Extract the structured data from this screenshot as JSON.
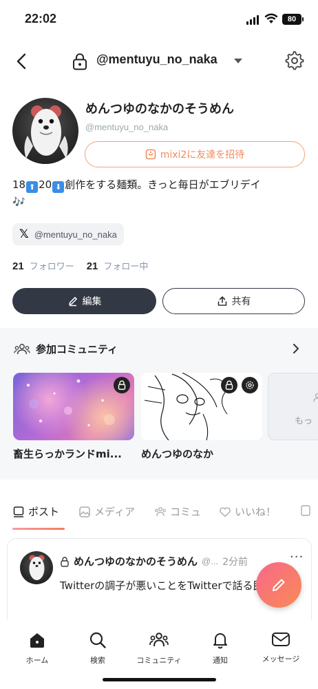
{
  "status_bar": {
    "time": "22:02",
    "battery": "80"
  },
  "header": {
    "username": "@mentuyu_no_naka"
  },
  "profile": {
    "display_name": "めんつゆのなかのそうめん",
    "handle": "@mentuyu_no_naka",
    "invite_label": "mixi2に友達を招待",
    "bio": {
      "age_from": "18",
      "up_arrow": "⬆",
      "age_to": "20",
      "down_arrow": "⬇",
      "text": "創作をする麺類。きっと毎日がエブリデイ",
      "note": "🎶"
    },
    "x_handle": "@mentuyu_no_naka",
    "followers_count": "21",
    "followers_label": "フォロワー",
    "following_count": "21",
    "following_label": "フォロー中",
    "edit_label": "編集",
    "share_label": "共有"
  },
  "community": {
    "title": "参加コミュニティ",
    "cards": [
      {
        "name": "畜生らっかランドmi..."
      },
      {
        "name": "めんつゆのなか"
      },
      {
        "name": "もっ"
      }
    ]
  },
  "tabs": [
    {
      "label": "ポスト",
      "icon": "post-icon"
    },
    {
      "label": "メディア",
      "icon": "media-icon"
    },
    {
      "label": "コミュ",
      "icon": "community-icon"
    },
    {
      "label": "いいね！",
      "icon": "heart-icon"
    }
  ],
  "post": {
    "author": "めんつゆのなかのそうめん",
    "handle": "@...",
    "time": "2分前",
    "more": "···",
    "text": "Twitterの調子が悪いことをTwitterで話る民"
  },
  "bottom_nav": [
    {
      "label": "ホーム",
      "icon": "home-icon"
    },
    {
      "label": "検索",
      "icon": "search-icon"
    },
    {
      "label": "コミュニティ",
      "icon": "community-icon"
    },
    {
      "label": "通知",
      "icon": "bell-icon"
    },
    {
      "label": "メッセージ",
      "icon": "message-icon"
    }
  ],
  "colors": {
    "accent": "#f28a5c",
    "dark_button": "#333845",
    "muted_label": "#8a96ad",
    "fab_gradient_start": "#f7688a",
    "fab_gradient_end": "#f98b55"
  }
}
